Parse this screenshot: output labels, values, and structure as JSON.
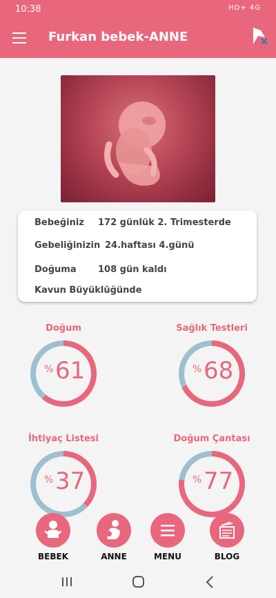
{
  "status": {
    "time": "10:38",
    "indicators": "HD+ 4G"
  },
  "app": {
    "title": "Furkan bebek-ANNE"
  },
  "info": [
    {
      "label": "Bebeğiniz",
      "value": "172 günlük 2. Trimesterde"
    },
    {
      "label": "Gebeliğinizin",
      "value": "24.haftası 4.günü"
    },
    {
      "label": "Doğuma",
      "value": "108 gün kaldı"
    },
    {
      "label": "Kavun Büyüklüğünde",
      "value": ""
    }
  ],
  "gauges": [
    {
      "label": "Doğum",
      "percent_sign": "%",
      "value": "61"
    },
    {
      "label": "Sağlık Testleri",
      "percent_sign": "%",
      "value": "68"
    },
    {
      "label": "İhtiyaç Listesi",
      "percent_sign": "%",
      "value": "37"
    },
    {
      "label": "Doğum Çantası",
      "percent_sign": "%",
      "value": "77"
    }
  ],
  "bottom_nav": [
    {
      "label": "BEBEK",
      "icon": "baby-icon"
    },
    {
      "label": "ANNE",
      "icon": "mother-icon"
    },
    {
      "label": "MENU",
      "icon": "menu-icon"
    },
    {
      "label": "BLOG",
      "icon": "blog-icon"
    }
  ],
  "colors": {
    "accent": "#e9677c",
    "remaining": "#9dbfd0"
  }
}
